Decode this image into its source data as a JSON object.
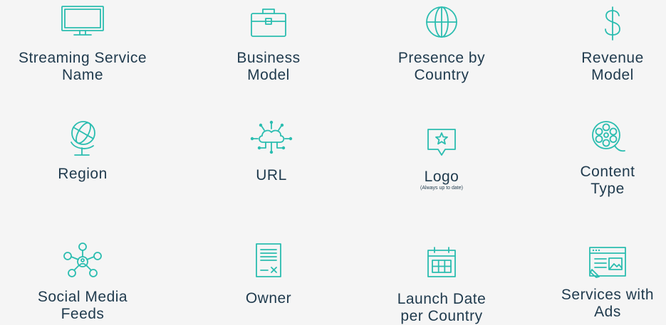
{
  "colors": {
    "accent": "#2bbdb0",
    "text": "#1f3a4d",
    "background": "#f5f5f5"
  },
  "items": [
    {
      "icon": "monitor-icon",
      "label": "Streaming Service\nName"
    },
    {
      "icon": "briefcase-icon",
      "label": "Business\nModel"
    },
    {
      "icon": "globe-icon",
      "label": "Presence by\nCountry"
    },
    {
      "icon": "dollar-icon",
      "label": "Revenue\nModel"
    },
    {
      "icon": "desk-globe-icon",
      "label": "Region"
    },
    {
      "icon": "cloud-network-icon",
      "label": "URL"
    },
    {
      "icon": "star-badge-icon",
      "label": "Logo",
      "note": "(Always up to date)"
    },
    {
      "icon": "film-reel-icon",
      "label": "Content\nType"
    },
    {
      "icon": "social-network-icon",
      "label": "Social Media\nFeeds"
    },
    {
      "icon": "document-icon",
      "label": "Owner"
    },
    {
      "icon": "calendar-icon",
      "label": "Launch Date\nper Country"
    },
    {
      "icon": "browser-ads-icon",
      "label": "Services with\nAds"
    }
  ]
}
